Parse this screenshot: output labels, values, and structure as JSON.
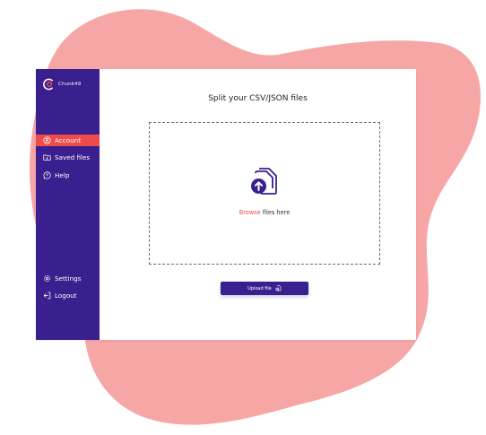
{
  "app": {
    "brand_name": "Chunk49"
  },
  "sidebar": {
    "items": [
      {
        "label": "Account",
        "icon": "user-icon",
        "active": true
      },
      {
        "label": "Saved files",
        "icon": "folder-icon",
        "active": false
      },
      {
        "label": "Help",
        "icon": "help-icon",
        "active": false
      }
    ],
    "bottom_items": [
      {
        "label": "Settings",
        "icon": "gear-icon"
      },
      {
        "label": "Logout",
        "icon": "logout-icon"
      }
    ]
  },
  "main": {
    "title": "Split your CSV/JSON files",
    "dropzone": {
      "icon": "file-upload-icon",
      "browse_label": "Browse",
      "suffix_label": " files here"
    },
    "upload_button": {
      "label": "Upload file",
      "icon": "upload-file-icon"
    }
  },
  "colors": {
    "primary": "#3a1f8f",
    "accent": "#ef4b4b",
    "blob": "#f7a6a6"
  }
}
